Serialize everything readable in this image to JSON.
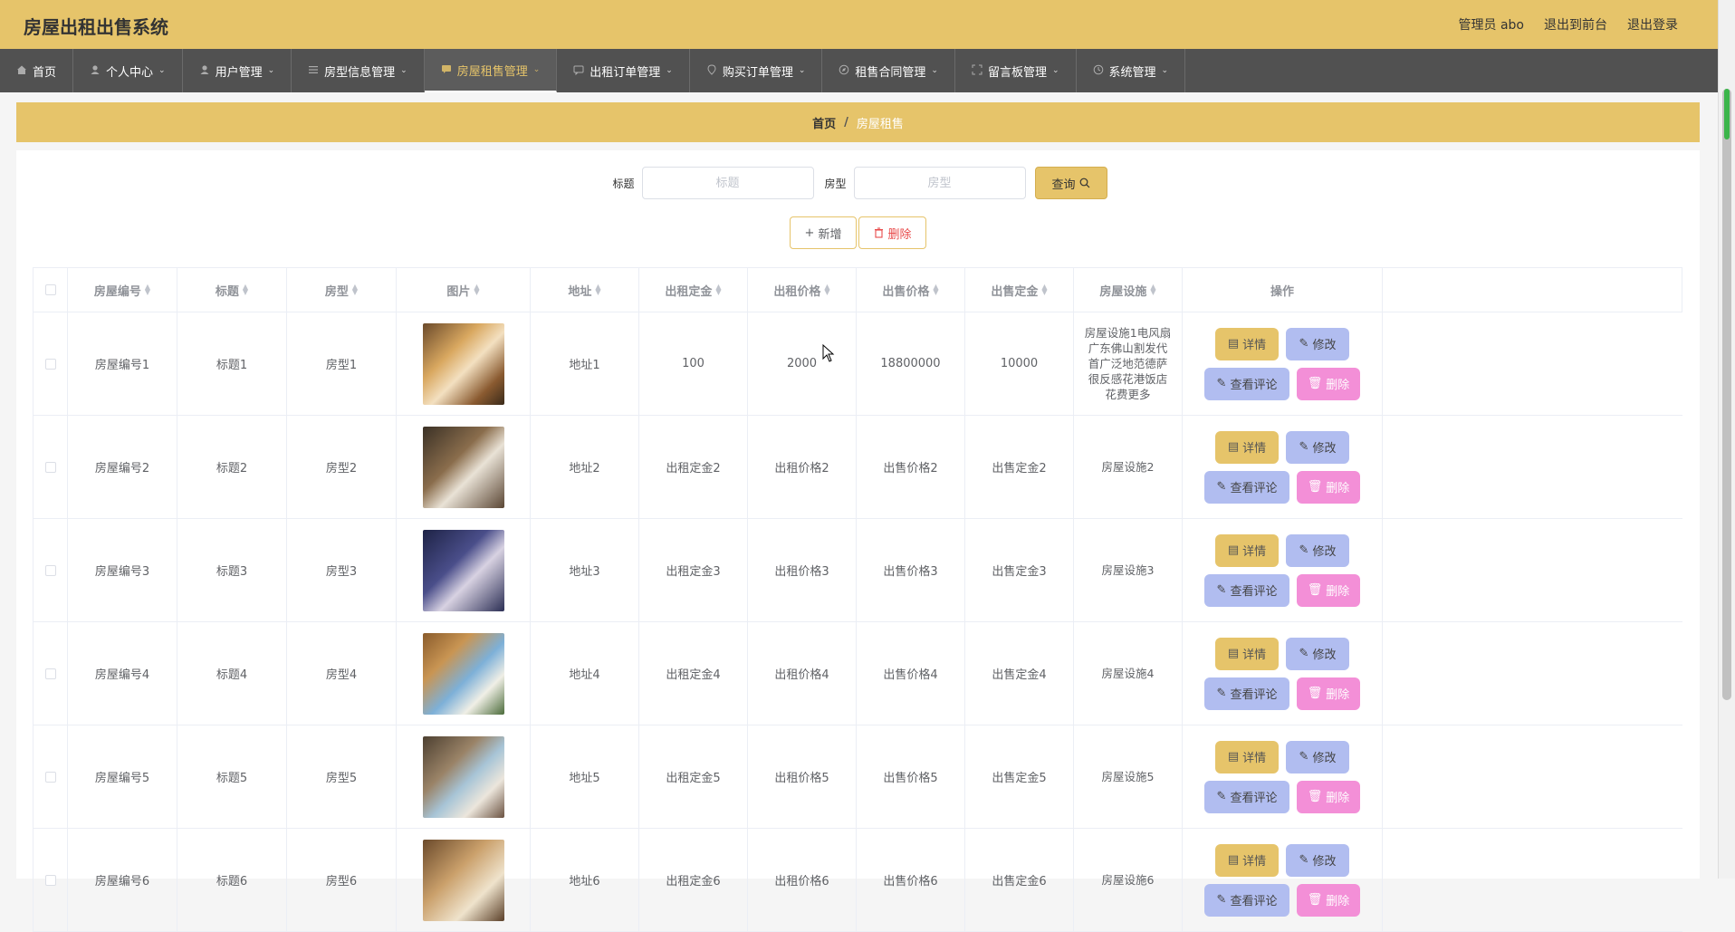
{
  "header": {
    "app_title": "房屋出租出售系统",
    "admin_label": "管理员 abo",
    "front_label": "退出到前台",
    "logout_label": "退出登录"
  },
  "nav": [
    {
      "label": "首页",
      "icon": "home-icon"
    },
    {
      "label": "个人中心",
      "icon": "user-icon"
    },
    {
      "label": "用户管理",
      "icon": "user-icon"
    },
    {
      "label": "房型信息管理",
      "icon": "list-icon"
    },
    {
      "label": "房屋租售管理",
      "icon": "message-icon",
      "active": true
    },
    {
      "label": "出租订单管理",
      "icon": "chat-icon"
    },
    {
      "label": "购买订单管理",
      "icon": "location-icon"
    },
    {
      "label": "租售合同管理",
      "icon": "compass-icon"
    },
    {
      "label": "留言板管理",
      "icon": "frame-icon"
    },
    {
      "label": "系统管理",
      "icon": "clock-icon"
    }
  ],
  "breadcrumb": {
    "home": "首页",
    "separator": "/",
    "current": "房屋租售"
  },
  "search": {
    "title_label": "标题",
    "title_placeholder": "标题",
    "type_label": "房型",
    "type_placeholder": "房型",
    "query_label": "查询"
  },
  "toolbar": {
    "add_label": "新增",
    "delete_label": "删除"
  },
  "columns": [
    "房屋编号",
    "标题",
    "房型",
    "图片",
    "地址",
    "出租定金",
    "出租价格",
    "出售价格",
    "出售定金",
    "房屋设施",
    "操作"
  ],
  "buttons": {
    "detail": "详情",
    "edit": "修改",
    "review": "查看评论",
    "remove": "删除"
  },
  "rows": [
    {
      "id": "房屋编号1",
      "title": "标题1",
      "type": "房型1",
      "address": "地址1",
      "rent_deposit": "100",
      "rent_price": "2000",
      "sale_price": "18800000",
      "sale_deposit": "10000",
      "facilities": "房屋设施1电风扇广东佛山割发代首广泛地范德萨很反感花港饭店花费更多"
    },
    {
      "id": "房屋编号2",
      "title": "标题2",
      "type": "房型2",
      "address": "地址2",
      "rent_deposit": "出租定金2",
      "rent_price": "出租价格2",
      "sale_price": "出售价格2",
      "sale_deposit": "出售定金2",
      "facilities": "房屋设施2"
    },
    {
      "id": "房屋编号3",
      "title": "标题3",
      "type": "房型3",
      "address": "地址3",
      "rent_deposit": "出租定金3",
      "rent_price": "出租价格3",
      "sale_price": "出售价格3",
      "sale_deposit": "出售定金3",
      "facilities": "房屋设施3"
    },
    {
      "id": "房屋编号4",
      "title": "标题4",
      "type": "房型4",
      "address": "地址4",
      "rent_deposit": "出租定金4",
      "rent_price": "出租价格4",
      "sale_price": "出售价格4",
      "sale_deposit": "出售定金4",
      "facilities": "房屋设施4"
    },
    {
      "id": "房屋编号5",
      "title": "标题5",
      "type": "房型5",
      "address": "地址5",
      "rent_deposit": "出租定金5",
      "rent_price": "出租价格5",
      "sale_price": "出售价格5",
      "sale_deposit": "出售定金5",
      "facilities": "房屋设施5"
    },
    {
      "id": "房屋编号6",
      "title": "标题6",
      "type": "房型6",
      "address": "地址6",
      "rent_deposit": "出租定金6",
      "rent_price": "出租价格6",
      "sale_price": "出售价格6",
      "sale_deposit": "出售定金6",
      "facilities": "房屋设施6"
    }
  ],
  "colors": {
    "accent": "#e6c46a",
    "nav_bg": "#515151",
    "edit_btn": "#b1bdf0",
    "delete_btn": "#f38fd7"
  }
}
